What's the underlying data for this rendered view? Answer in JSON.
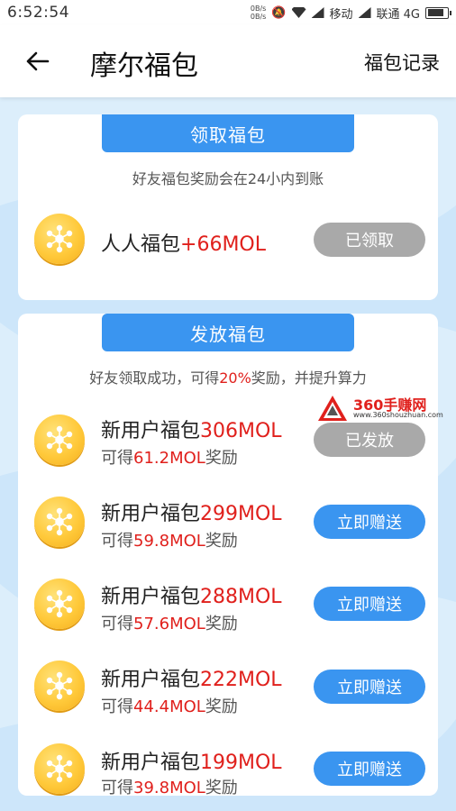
{
  "status_bar": {
    "time": "6:52:54",
    "net_up": "0B/s",
    "net_down": "0B/s",
    "carrier1": "移动",
    "carrier2": "联通 4G"
  },
  "header": {
    "title": "摩尔福包",
    "records_link": "福包记录"
  },
  "receive_section": {
    "tab_label": "领取福包",
    "note": "好友福包奖励会在24小内到账",
    "items": [
      {
        "name": "人人福包",
        "amount": "+66MOL",
        "button": "已领取"
      }
    ]
  },
  "send_section": {
    "tab_label": "发放福包",
    "note_before": "好友领取成功，可得",
    "note_percent": "20%",
    "note_after": "奖励，并提升算力",
    "items": [
      {
        "name": "新用户福包",
        "amount": "306MOL",
        "reward_prefix": "可得",
        "reward": "61.2MOL",
        "reward_suffix": "奖励",
        "button": "已发放",
        "state": "sent"
      },
      {
        "name": "新用户福包",
        "amount": "299MOL",
        "reward_prefix": "可得",
        "reward": "59.8MOL",
        "reward_suffix": "奖励",
        "button": "立即赠送",
        "state": "available"
      },
      {
        "name": "新用户福包",
        "amount": "288MOL",
        "reward_prefix": "可得",
        "reward": "57.6MOL",
        "reward_suffix": "奖励",
        "button": "立即赠送",
        "state": "available"
      },
      {
        "name": "新用户福包",
        "amount": "222MOL",
        "reward_prefix": "可得",
        "reward": "44.4MOL",
        "reward_suffix": "奖励",
        "button": "立即赠送",
        "state": "available"
      },
      {
        "name": "新用户福包",
        "amount": "199MOL",
        "reward_prefix": "可得",
        "reward": "39.8MOL",
        "reward_suffix": "奖励",
        "button": "立即赠送",
        "state": "available"
      }
    ]
  },
  "watermark": {
    "brand": "360手赚网",
    "url": "www.360shouzhuan.com"
  },
  "colors": {
    "accent_blue": "#3a95f0",
    "highlight_red": "#e0201c",
    "disabled_gray": "#a9a9a9",
    "background": "#dceefb"
  },
  "icons": {
    "back": "arrow-left-icon",
    "coin": "coin-network-icon"
  }
}
